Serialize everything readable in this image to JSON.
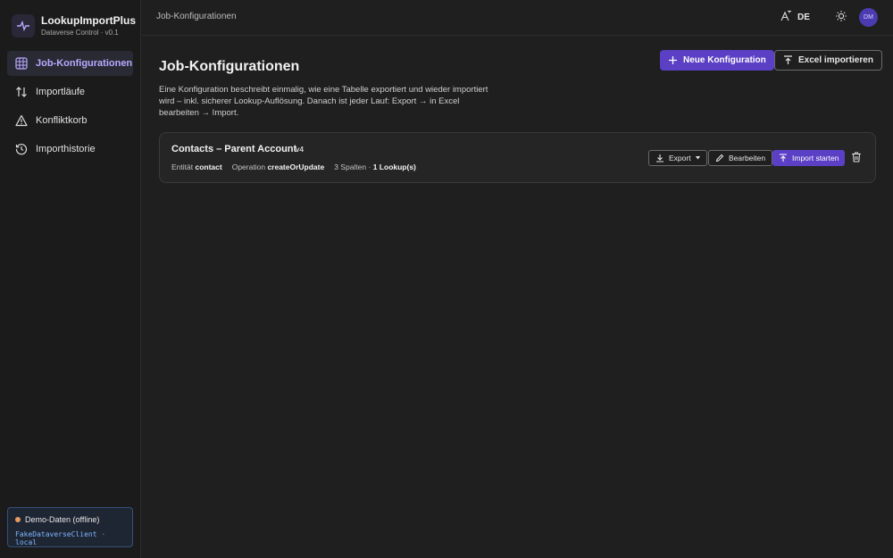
{
  "brand": {
    "title": "LookupImportPlus",
    "subtitle": "Dataverse Control · v0.1"
  },
  "sidebar": {
    "items": [
      {
        "label": "Job-Konfigurationen",
        "icon": "table-grid-icon",
        "active": true
      },
      {
        "label": "Importläufe",
        "icon": "arrows-up-down-icon",
        "active": false
      },
      {
        "label": "Konfliktkorb",
        "icon": "warning-triangle-icon",
        "active": false
      },
      {
        "label": "Importhistorie",
        "icon": "history-clock-icon",
        "active": false
      }
    ],
    "demo": {
      "status": "Demo-Daten (offline)",
      "client": "FakeDataverseClient",
      "separator": "·",
      "mode": "local"
    }
  },
  "topbar": {
    "breadcrumb": "Job-Konfigurationen",
    "language": "DE",
    "avatar_initials": "DM"
  },
  "main": {
    "title": "Job-Konfigurationen",
    "description": "Eine Konfiguration beschreibt einmalig, wie eine Tabelle exportiert und wieder importiert wird – inkl. sicherer Lookup-Auflösung. Danach ist jeder Lauf: Export → in Excel bearbeiten → Import.",
    "new_config_label": "Neue Konfiguration",
    "import_excel_label": "Excel importieren"
  },
  "config_card": {
    "title": "Contacts – Parent Account",
    "version": "v4",
    "entity_label": "Entität",
    "entity_value": "contact",
    "operation_label": "Operation",
    "operation_value": "createOrUpdate",
    "columns": "3 Spalten ·",
    "lookups": "1 Lookup(s)",
    "export_label": "Export",
    "edit_label": "Bearbeiten",
    "start_import_label": "Import starten"
  },
  "colors": {
    "accent": "#5b3fc4",
    "active_nav_text": "#b9a9ff",
    "demo_dot": "#e59a62",
    "mono_text": "#7fb5ff"
  }
}
